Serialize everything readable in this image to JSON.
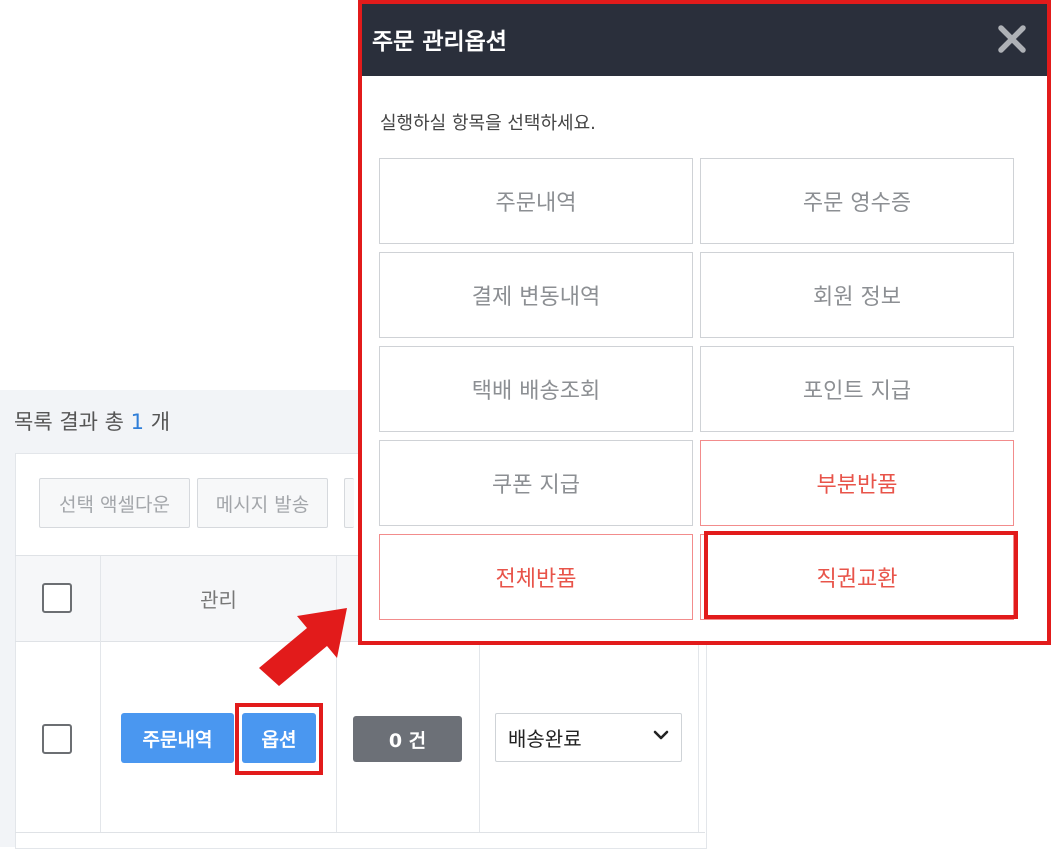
{
  "list": {
    "result_prefix": "목록 결과 총",
    "result_count": "1",
    "result_suffix": "개",
    "toolbar": {
      "excel_label": "선택 액셀다운",
      "message_label": "메시지 발송"
    },
    "columns": {
      "manage": "관리"
    },
    "row": {
      "order_history_label": "주문내역",
      "option_label": "옵션",
      "count_label": "0 건",
      "status_value": "배송완료"
    }
  },
  "modal": {
    "title": "주문 관리옵션",
    "message": "실행하실 항목을 선택하세요.",
    "options": [
      {
        "label": "주문내역"
      },
      {
        "label": "주문 영수증"
      },
      {
        "label": "결제 변동내역"
      },
      {
        "label": "회원 정보"
      },
      {
        "label": "택배 배송조회"
      },
      {
        "label": "포인트 지급"
      },
      {
        "label": "쿠폰 지급"
      },
      {
        "label": "부분반품"
      },
      {
        "label": "전체반품"
      },
      {
        "label": "직권교환"
      }
    ]
  },
  "colors": {
    "highlight": "#e21b1b",
    "header_bg": "#2a2f3b",
    "primary": "#4a97f0",
    "danger_text": "#e8544a"
  }
}
